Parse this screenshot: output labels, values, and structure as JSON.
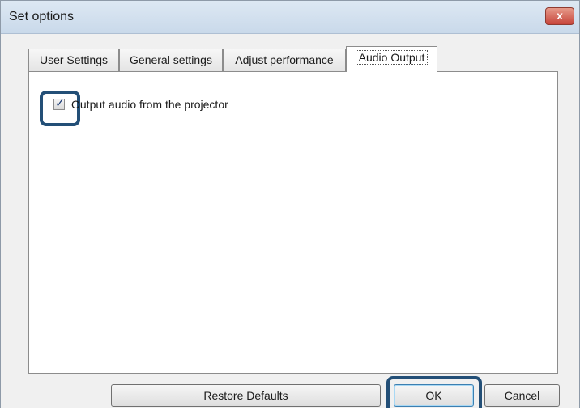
{
  "window": {
    "title": "Set options",
    "close_glyph": "x"
  },
  "tabs": [
    {
      "label": "User Settings",
      "active": false
    },
    {
      "label": "General settings",
      "active": false
    },
    {
      "label": "Adjust performance",
      "active": false
    },
    {
      "label": "Audio Output",
      "active": true
    }
  ],
  "audio_output": {
    "checkbox_label": "Output audio from the projector",
    "checked": true
  },
  "buttons": {
    "restore_defaults": "Restore Defaults",
    "ok": "OK",
    "cancel": "Cancel"
  },
  "colors": {
    "highlight": "#234f77"
  },
  "icons": {
    "close": "close-icon",
    "check": "checkmark-icon"
  }
}
